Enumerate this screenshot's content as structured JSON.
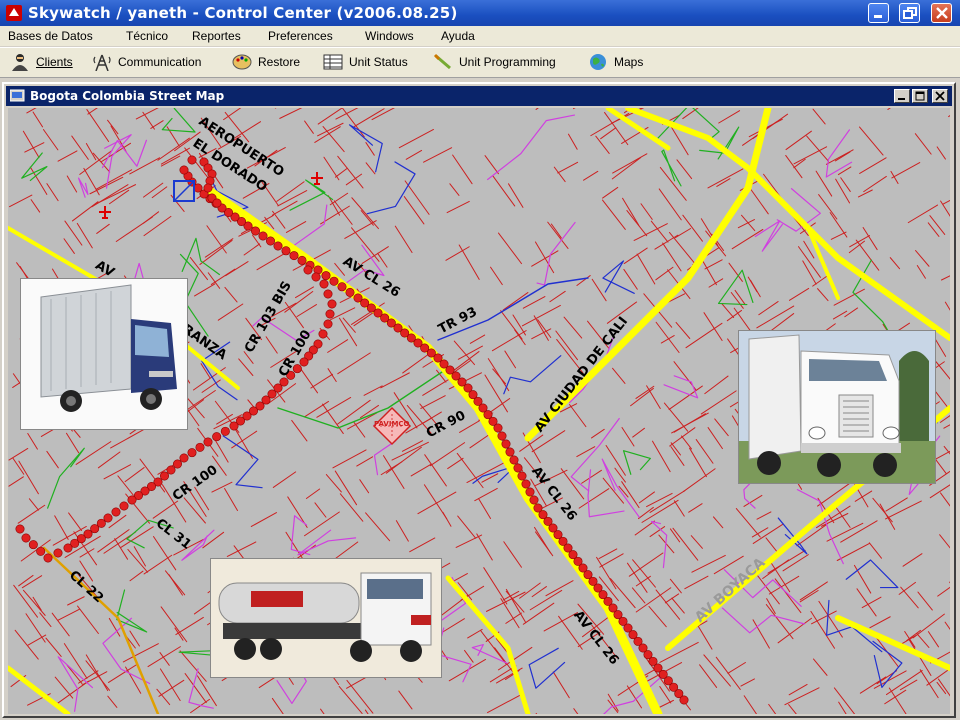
{
  "window": {
    "title": "Skywatch / yaneth - Control Center (v2006.08.25)"
  },
  "menu": [
    "Bases de Datos",
    "Técnico",
    "Reportes",
    "Preferences",
    "Windows",
    "Ayuda"
  ],
  "toolbar": {
    "clients": "Clients",
    "communication": "Communication",
    "restore": "Restore",
    "unit_status": "Unit Status",
    "unit_programming": "Unit Programming",
    "maps": "Maps"
  },
  "child_window": {
    "title": "Bogota Colombia Street Map"
  },
  "map": {
    "labels": {
      "airport_1": "AEROPUERTO",
      "airport_2": "EL DORADO",
      "av_cl26_a": "AV CL 26",
      "av_cl26_b": "AV CL 26",
      "av_cl26_c": "AV CL 26",
      "tr93": "TR 93",
      "cr103bis": "CR 103 BIS",
      "cr100_a": "CR 100",
      "cr100_b": "CR 100",
      "av_left": "AV",
      "esperanza": "RANZA",
      "ciudad_cali": "AV CIUDAD DE CALI",
      "cr90": "CR 90",
      "cl31": "CL 31",
      "cl22": "CL 22",
      "av_boyaca": "AV BOYACA",
      "poi": "PAVIMCO"
    },
    "colors": {
      "background": "#bdbdbd",
      "arterial": "#ffff00",
      "street_red": "#cc2020",
      "street_magenta": "#d040e0",
      "street_blue": "#2030d0",
      "street_green": "#20b020",
      "route_dot": "#e02020"
    }
  }
}
